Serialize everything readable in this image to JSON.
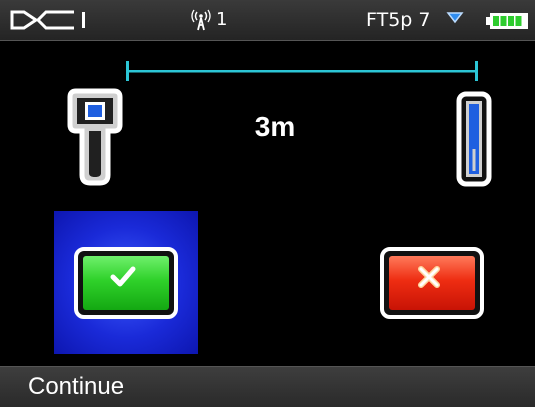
{
  "status_bar": {
    "logo_text": "DCI",
    "signal_icon": "antenna-signal-icon",
    "channel_value": "1",
    "frequency_label": "FT5p 7",
    "dropdown_icon": "triangle-down-icon",
    "battery_icon": "battery-full-icon",
    "battery_color": "#2ecc2e"
  },
  "main": {
    "distance_label": "3m",
    "line_color": "#2cc6d6",
    "locator_icon": "locator-receiver-icon",
    "transmitter_icon": "transmitter-icon",
    "confirm_icon": "checkmark-icon",
    "cancel_icon": "x-icon",
    "confirm_color": "#2fd12a",
    "cancel_color": "#ee2d12",
    "selection_color": "#1a2ad8"
  },
  "footer": {
    "action_label": "Continue"
  }
}
